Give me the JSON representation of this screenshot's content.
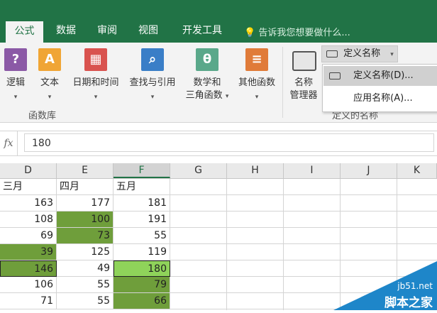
{
  "ribbon": {
    "tabs": [
      "公式",
      "数据",
      "审阅",
      "视图",
      "开发工具"
    ],
    "tell_me": "告诉我您想要做什么...",
    "buttons": [
      {
        "label": "逻辑",
        "icon": "logical-icon",
        "color": "#8b59a6",
        "glyph": "?"
      },
      {
        "label": "文本",
        "icon": "text-icon",
        "color": "#f0a535",
        "glyph": "A"
      },
      {
        "label": "日期和时间",
        "icon": "datetime-icon",
        "color": "#d9534f",
        "glyph": "▦"
      },
      {
        "label": "查找与引用",
        "icon": "lookup-icon",
        "color": "#3a7ec7",
        "glyph": "⌕"
      },
      {
        "label1": "数学和",
        "label2": "三角函数",
        "icon": "math-icon",
        "color": "#5aa88a",
        "glyph": "θ"
      },
      {
        "label": "其他函数",
        "icon": "more-functions-icon",
        "color": "#e07b39",
        "glyph": "≡"
      }
    ],
    "group_label_1": "函数库",
    "name_manager_1": "名称",
    "name_manager_2": "管理器",
    "define_name": "定义名称",
    "group_label_2": "定义的名称",
    "dropdown": [
      "定义名称(D)...",
      "应用名称(A)..."
    ]
  },
  "formula_bar": {
    "fx": "fx",
    "value": "180"
  },
  "grid": {
    "columns": [
      "D",
      "E",
      "F",
      "G",
      "H",
      "I",
      "J",
      "K"
    ],
    "selected_column": "F",
    "header_row": [
      "三月",
      "四月",
      "五月"
    ],
    "rows": [
      [
        "163",
        "177",
        "181"
      ],
      [
        "108",
        "100",
        "191"
      ],
      [
        "69",
        "73",
        "55"
      ],
      [
        "39",
        "125",
        "119"
      ],
      [
        "146",
        "49",
        "180"
      ],
      [
        "106",
        "55",
        "79"
      ],
      [
        "71",
        "55",
        "66"
      ]
    ]
  },
  "watermark": {
    "line1": "jb51.net",
    "line2": "脚本之家"
  }
}
